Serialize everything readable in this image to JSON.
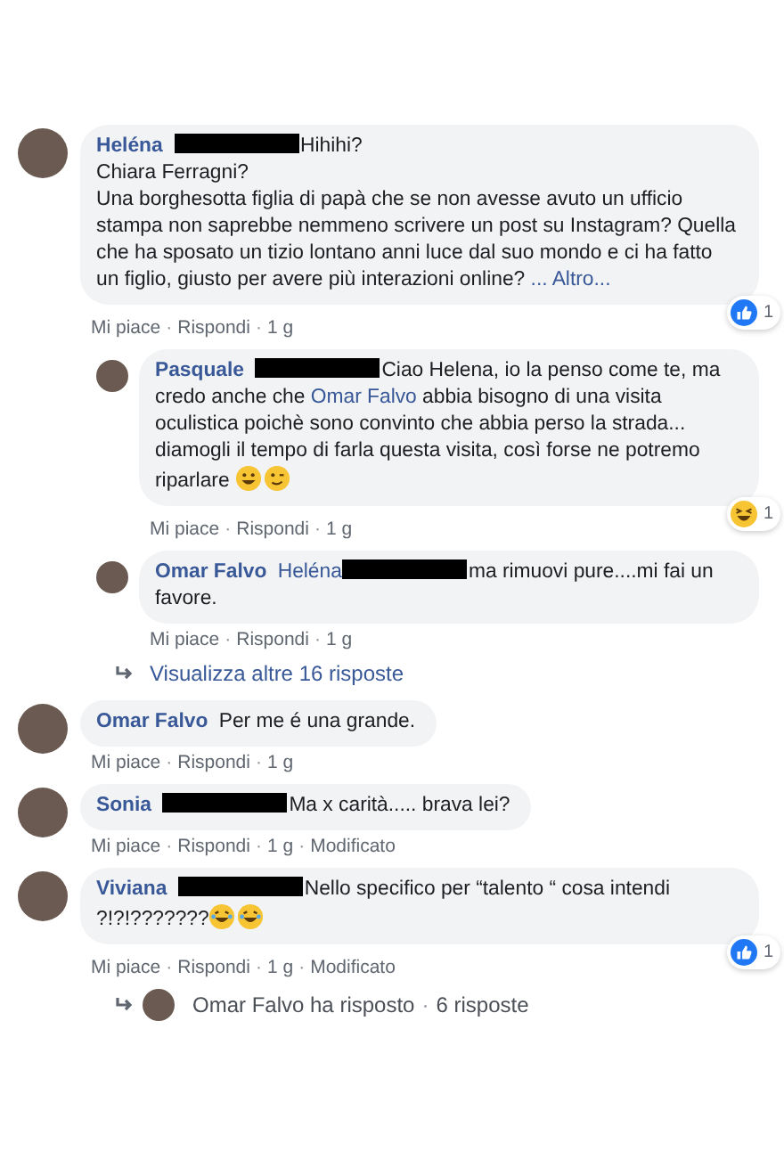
{
  "comments": [
    {
      "author": "Heléna",
      "body": [
        {
          "kind": "redaction"
        },
        {
          "kind": "text",
          "text": "Hihihi?\nChiara Ferragni?\nUna borghesotta figlia di papà che se non avesse avuto un ufficio stampa non saprebbe nemmeno scrivere un post su Instagram? Quella che ha sposato un tizio lontano anni luce dal suo mondo e ci ha fatto un figlio, giusto per avere più interazioni online? "
        },
        {
          "kind": "link",
          "text": "... Altro..."
        }
      ],
      "reaction": {
        "kind": "like",
        "count": "1"
      },
      "meta": [
        {
          "kind": "link",
          "text": "Mi piace"
        },
        {
          "kind": "sep",
          "text": "·"
        },
        {
          "kind": "link",
          "text": "Rispondi"
        },
        {
          "kind": "sep",
          "text": "·"
        },
        {
          "kind": "text",
          "text": "1 g"
        }
      ],
      "replies": [
        {
          "author": "Pasquale",
          "body": [
            {
              "kind": "redaction"
            },
            {
              "kind": "text",
              "text": "Ciao Helena, io la penso come te, ma credo anche che "
            },
            {
              "kind": "link",
              "text": "Omar Falvo"
            },
            {
              "kind": "text",
              "text": " abbia bisogno di una visita oculistica poichè sono convinto che abbia perso la strada... diamogli il tempo di farla questa visita, così forse ne potremo riparlare "
            },
            {
              "kind": "smiley"
            },
            {
              "kind": "wink"
            }
          ],
          "reaction": {
            "kind": "haha",
            "count": "1"
          },
          "meta": [
            {
              "kind": "link",
              "text": "Mi piace"
            },
            {
              "kind": "sep",
              "text": "·"
            },
            {
              "kind": "link",
              "text": "Rispondi"
            },
            {
              "kind": "sep",
              "text": "·"
            },
            {
              "kind": "text",
              "text": "1 g"
            }
          ]
        },
        {
          "author": "Omar Falvo",
          "body": [
            {
              "kind": "link",
              "text": "Heléna"
            },
            {
              "kind": "redaction"
            },
            {
              "kind": "text",
              "text": "ma rimuovi pure....mi fai un favore."
            }
          ],
          "meta": [
            {
              "kind": "link",
              "text": "Mi piace"
            },
            {
              "kind": "sep",
              "text": "·"
            },
            {
              "kind": "link",
              "text": "Rispondi"
            },
            {
              "kind": "sep",
              "text": "·"
            },
            {
              "kind": "text",
              "text": "1 g"
            }
          ]
        }
      ],
      "more_replies": "Visualizza altre 16 risposte"
    },
    {
      "author": "Omar Falvo",
      "body": [
        {
          "kind": "text",
          "text": "Per me é una grande."
        }
      ],
      "meta": [
        {
          "kind": "link",
          "text": "Mi piace"
        },
        {
          "kind": "sep",
          "text": "·"
        },
        {
          "kind": "link",
          "text": "Rispondi"
        },
        {
          "kind": "sep",
          "text": "·"
        },
        {
          "kind": "text",
          "text": "1 g"
        }
      ]
    },
    {
      "author": "Sonia",
      "body": [
        {
          "kind": "redaction"
        },
        {
          "kind": "text",
          "text": "Ma x carità..... brava lei?"
        }
      ],
      "meta": [
        {
          "kind": "link",
          "text": "Mi piace"
        },
        {
          "kind": "sep",
          "text": "·"
        },
        {
          "kind": "link",
          "text": "Rispondi"
        },
        {
          "kind": "sep",
          "text": "·"
        },
        {
          "kind": "text",
          "text": "1 g"
        },
        {
          "kind": "sep",
          "text": "·"
        },
        {
          "kind": "text",
          "text": "Modificato"
        }
      ]
    },
    {
      "author": "Viviana",
      "body": [
        {
          "kind": "redaction"
        },
        {
          "kind": "text",
          "text": "Nello specifico per “talento “ cosa intendi ?!?!???????"
        },
        {
          "kind": "tears"
        },
        {
          "kind": "tears"
        }
      ],
      "reaction": {
        "kind": "like",
        "count": "1"
      },
      "meta": [
        {
          "kind": "link",
          "text": "Mi piace"
        },
        {
          "kind": "sep",
          "text": "·"
        },
        {
          "kind": "link",
          "text": "Rispondi"
        },
        {
          "kind": "sep",
          "text": "·"
        },
        {
          "kind": "text",
          "text": "1 g"
        },
        {
          "kind": "sep",
          "text": "·"
        },
        {
          "kind": "text",
          "text": "Modificato"
        }
      ],
      "reply_summary": [
        {
          "kind": "link",
          "text": "Omar Falvo ha risposto"
        },
        {
          "kind": "sep",
          "text": "·"
        },
        {
          "kind": "link",
          "text": "6 risposte"
        }
      ]
    }
  ]
}
